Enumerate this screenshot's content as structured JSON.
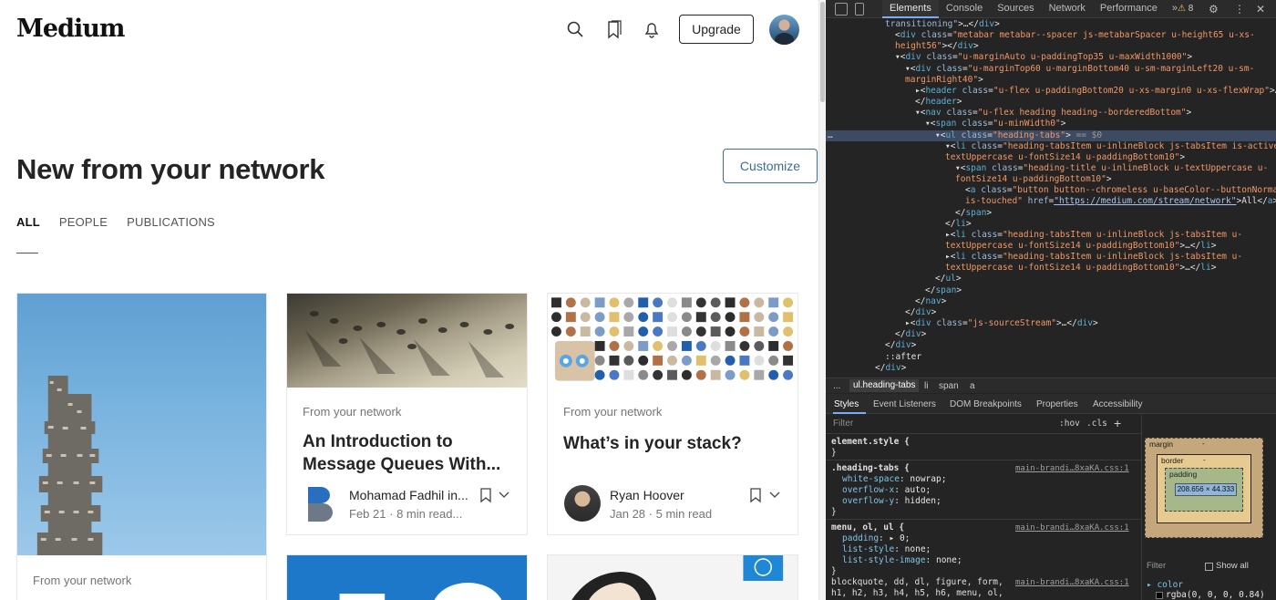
{
  "medium": {
    "logo": "Medium",
    "upgrade_label": "Upgrade",
    "icons": [
      "search-icon",
      "bookmarks-icon",
      "notifications-icon"
    ],
    "title": "New from your network",
    "customize_label": "Customize",
    "tabs": [
      {
        "label": "ALL",
        "active": true
      },
      {
        "label": "PEOPLE",
        "active": false
      },
      {
        "label": "PUBLICATIONS",
        "active": false
      }
    ],
    "cards": [
      {
        "kicker": "From your network"
      },
      {
        "kicker": "From your network",
        "title_line1": "An Introduction to",
        "title_line2": "Message Queues With...",
        "author": "Mohamad Fadhil in...",
        "date": "Feb 21",
        "read": "8 min read..."
      },
      {
        "kicker": "From your network",
        "title_line1": "What’s in your stack?",
        "author": "Ryan Hoover",
        "date": "Jan 28",
        "read": "5 min read"
      }
    ],
    "accent_color": "#3b6e94"
  },
  "devtools": {
    "tabs": [
      "Elements",
      "Console",
      "Sources",
      "Network",
      "Performance"
    ],
    "active_tab": "Elements",
    "more_tabs": "»",
    "warnings": "8",
    "dom": [
      {
        "indent": 0,
        "html": "<span class=\"a\">transitioning\"</span>&gt;…&lt;/<span class=\"t\">div</span>&gt;"
      },
      {
        "indent": 1,
        "html": "&lt;<span class=\"t\">div</span> <span class=\"a\">class</span>=<span class=\"v\">\"metabar metabar--spacer js-metabarSpacer u-height65 u-xs-</span>"
      },
      {
        "indent": 1,
        "html": "<span class=\"v\">height56\"</span>&gt;&lt;/<span class=\"t\">div</span>&gt;"
      },
      {
        "indent": 1,
        "html": "▾&lt;<span class=\"t\">div</span> <span class=\"a\">class</span>=<span class=\"v\">\"u-marginAuto u-paddingTop35 u-maxWidth1000\"</span>&gt;"
      },
      {
        "indent": 2,
        "html": "▾&lt;<span class=\"t\">div</span> <span class=\"a\">class</span>=<span class=\"v\">\"u-marginTop60 u-marginBottom40 u-sm-marginLeft20 u-sm-</span>"
      },
      {
        "indent": 2,
        "html": "<span class=\"v\">marginRight40\"</span>&gt;"
      },
      {
        "indent": 3,
        "html": "▸&lt;<span class=\"t\">header</span> <span class=\"a\">class</span>=<span class=\"v\">\"u-flex u-paddingBottom20 u-xs-margin0 u-xs-flexWrap\"</span>&gt;…"
      },
      {
        "indent": 3,
        "html": "&lt;/<span class=\"t\">header</span>&gt;"
      },
      {
        "indent": 3,
        "html": "▾&lt;<span class=\"t\">nav</span> <span class=\"a\">class</span>=<span class=\"v\">\"u-flex heading heading--borderedBottom\"</span>&gt;"
      },
      {
        "indent": 4,
        "html": "▾&lt;<span class=\"t\">span</span> <span class=\"a\">class</span>=<span class=\"v\">\"u-minWidth0\"</span>&gt;"
      },
      {
        "indent": 5,
        "html": "▾&lt;<span class=\"t\">ul</span> <span class=\"a\">class</span>=<span class=\"v\">\"heading-tabs\"</span>&gt; <span class=\"c\">== $0</span>",
        "selected": true
      },
      {
        "indent": 6,
        "html": "▾&lt;<span class=\"t\">li</span> <span class=\"a\">class</span>=<span class=\"v\">\"heading-tabsItem u-inlineBlock js-tabsItem is-active u-</span>"
      },
      {
        "indent": 6,
        "html": "<span class=\"v\">textUppercase u-fontSize14 u-paddingBottom10\"</span>&gt;"
      },
      {
        "indent": 7,
        "html": "▾&lt;<span class=\"t\">span</span> <span class=\"a\">class</span>=<span class=\"v\">\"heading-title u-inlineBlock u-textUppercase u-</span>"
      },
      {
        "indent": 7,
        "html": "<span class=\"v\">fontSize14 u-paddingBottom10\"</span>&gt;"
      },
      {
        "indent": 8,
        "html": "&lt;<span class=\"t\">a</span> <span class=\"a\">class</span>=<span class=\"v\">\"button button--chromeless u-baseColor--buttonNormal</span>"
      },
      {
        "indent": 8,
        "html": "<span class=\"v\">is-touched\"</span> <span class=\"a\">href</span>=<span class=\"u\">\"https://medium.com/stream/network\"</span>&gt;All&lt;/<span class=\"t\">a</span>&gt;"
      },
      {
        "indent": 7,
        "html": "&lt;/<span class=\"t\">span</span>&gt;"
      },
      {
        "indent": 6,
        "html": "&lt;/<span class=\"t\">li</span>&gt;"
      },
      {
        "indent": 6,
        "html": "▸&lt;<span class=\"t\">li</span> <span class=\"a\">class</span>=<span class=\"v\">\"heading-tabsItem u-inlineBlock js-tabsItem u-</span>"
      },
      {
        "indent": 6,
        "html": "<span class=\"v\">textUppercase u-fontSize14 u-paddingBottom10\"</span>&gt;…&lt;/<span class=\"t\">li</span>&gt;"
      },
      {
        "indent": 6,
        "html": "▸&lt;<span class=\"t\">li</span> <span class=\"a\">class</span>=<span class=\"v\">\"heading-tabsItem u-inlineBlock js-tabsItem u-</span>"
      },
      {
        "indent": 6,
        "html": "<span class=\"v\">textUppercase u-fontSize14 u-paddingBottom10\"</span>&gt;…&lt;/<span class=\"t\">li</span>&gt;"
      },
      {
        "indent": 5,
        "html": "&lt;/<span class=\"t\">ul</span>&gt;"
      },
      {
        "indent": 4,
        "html": "&lt;/<span class=\"t\">span</span>&gt;"
      },
      {
        "indent": 3,
        "html": "&lt;/<span class=\"t\">nav</span>&gt;"
      },
      {
        "indent": 2,
        "html": "&lt;/<span class=\"t\">div</span>&gt;"
      },
      {
        "indent": 2,
        "html": "▸&lt;<span class=\"t\">div</span> <span class=\"a\">class</span>=<span class=\"v\">\"js-sourceStream\"</span>&gt;…&lt;/<span class=\"t\">div</span>&gt;"
      },
      {
        "indent": 1,
        "html": "&lt;/<span class=\"t\">div</span>&gt;"
      },
      {
        "indent": 0,
        "html": "&lt;/<span class=\"t\">div</span>&gt;"
      },
      {
        "indent": 0,
        "html": "::after"
      },
      {
        "indent": -1,
        "html": "&lt;/<span class=\"t\">div</span>&gt;"
      }
    ],
    "breadcrumbs": [
      "...",
      "ul.heading-tabs",
      "li",
      "span",
      "a"
    ],
    "sub_tabs": [
      "Styles",
      "Event Listeners",
      "DOM Breakpoints",
      "Properties",
      "Accessibility"
    ],
    "filter_placeholder": "Filter",
    "hov": ":hov",
    "cls": ".cls",
    "plus": "+",
    "styles": [
      {
        "text": "element.style {",
        "src": ""
      },
      {
        "text": "}",
        "src": ""
      },
      {
        "text": ".heading-tabs {",
        "src": "main-brandi…8xaKA.css:1"
      },
      {
        "prop": "white-space",
        "val": "nowrap;"
      },
      {
        "prop": "overflow-x",
        "val": "auto;"
      },
      {
        "prop": "overflow-y",
        "val": "hidden;"
      },
      {
        "text": "}",
        "src": ""
      },
      {
        "text": "menu, ol, ul {",
        "src": "main-brandi…8xaKA.css:1"
      },
      {
        "prop": "padding",
        "val": "▸ 0;"
      },
      {
        "prop": "list-style",
        "val": "none;"
      },
      {
        "prop": "list-style-image",
        "val": "none;"
      },
      {
        "text": "}",
        "src": ""
      },
      {
        "text": "blockquote, dd, dl, figure, form,",
        "src": "main-brandi…8xaKA.css:1"
      },
      {
        "text": "h1, h2, h3, h4, h5, h6, menu, ol,",
        "src": ""
      }
    ],
    "boxmodel": {
      "margin_label": "margin",
      "border_label": "border",
      "padding_label": "padding",
      "content": "208.656 × 44.333",
      "dash": "-"
    },
    "computed_filter": "Filter",
    "show_all": "Show all",
    "computed_prop": "▸ color",
    "computed_val": "rgba(0, 0, 0, 0.84)"
  }
}
